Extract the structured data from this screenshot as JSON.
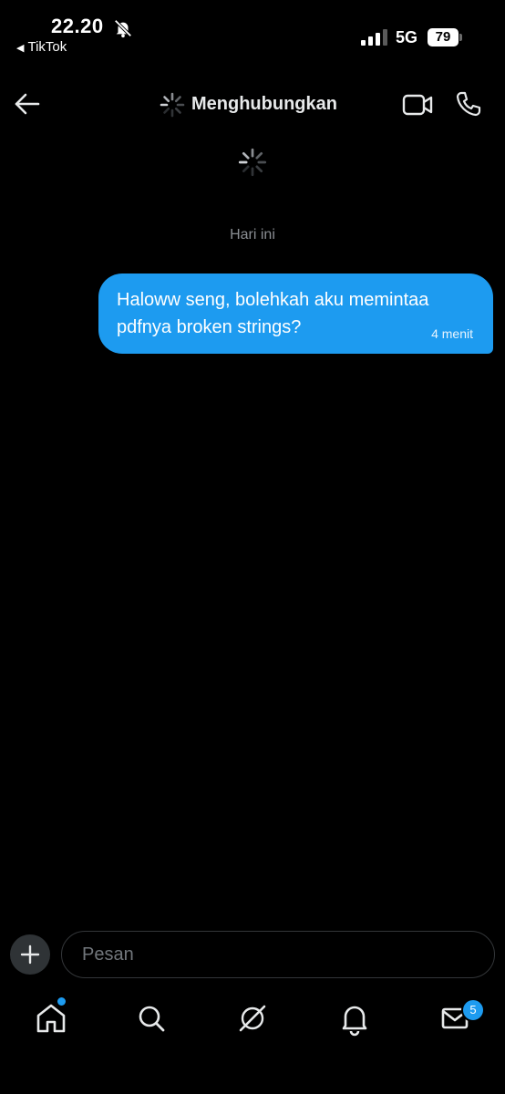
{
  "status_bar": {
    "time": "22.20",
    "back_app": "TikTok",
    "network": "5G",
    "battery": "79"
  },
  "header": {
    "title": "Menghubungkan"
  },
  "conversation": {
    "date_label": "Hari ini",
    "messages": [
      {
        "text": "Haloww seng, bolehkah aku memintaa pdfnya broken strings?",
        "time": "4 menit"
      }
    ]
  },
  "composer": {
    "placeholder": "Pesan"
  },
  "bottom_nav": {
    "messages_badge": "5",
    "items": [
      "home-icon",
      "search-icon",
      "grok-icon",
      "bell-icon",
      "mail-icon"
    ]
  },
  "colors": {
    "accent": "#1d9bf0",
    "background": "#000000",
    "muted_text": "#8b8f94"
  }
}
